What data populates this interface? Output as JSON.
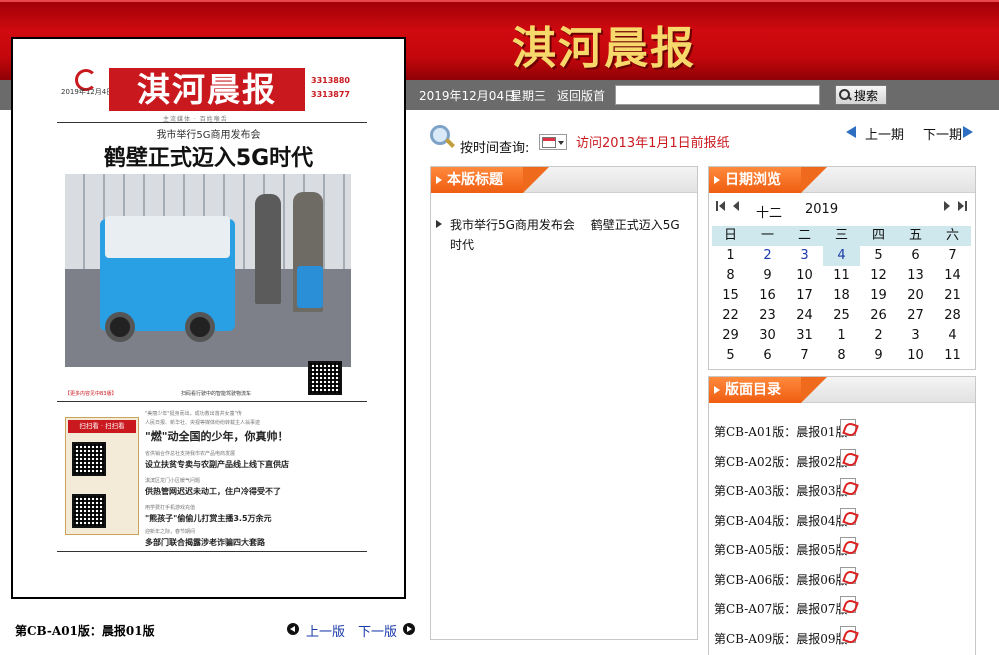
{
  "header": {
    "site_title": "淇河晨报",
    "date": "2019年12月04日",
    "weekday": "星期三",
    "home_link": "返回版首",
    "search_button": "搜索",
    "search_placeholder": ""
  },
  "newspaper": {
    "masthead": "淇河晨报",
    "issue_date": "2019年12月4日",
    "tel1": "3313880",
    "tel2": "3313877",
    "slogan": "主流媒体 · 百姓喉舌",
    "kicker": "我市举行5G商用发布会",
    "headline": "鹤壁正式迈入5G时代",
    "photo_note": "【更多内容见中B3版】",
    "qr_note": "扫码看行驶中的智能驾驶物流车",
    "box_tab": "扫扫看 · 扫扫看",
    "items": [
      {
        "kicker": "\"美丽少年\"挺身而出，成功救出落井女童\"传",
        "sub": "人民日报、新华社、央视等媒体纷纷转载主人翁事迹",
        "title": "\"燃\"动全国的少年，你真帅！",
        "ref": "详见03版"
      },
      {
        "kicker": "省供销合作总社支持我市农产品电商发展",
        "title": "设立扶贫专卖与农副产品线上线下直供店",
        "ref": "详见02版"
      },
      {
        "kicker": "淇滨区龙门小区暖气问题",
        "title": "供热管网迟迟未动工，住户冷得受不了",
        "ref": "详见07版"
      },
      {
        "kicker": "用学费打手机游戏充值",
        "title": "\"熊孩子\"偷偷儿打赏主播3.5万余元",
        "ref": "详见07版"
      },
      {
        "kicker": "迎新年之际，春节期间",
        "title": "多部门联合揭露涉老诈骗四大套路",
        "ref": "详见09版"
      }
    ]
  },
  "current_edition": "第CB-A01版：晨报01版",
  "pager": {
    "prev_edition": "上一版",
    "next_edition": "下一版"
  },
  "query": {
    "label": "按时间查询:",
    "archive_link": "访问2013年1月1日前报纸",
    "prev_period": "上一期",
    "next_period": "下一期"
  },
  "headline_panel": {
    "title": "本版标题",
    "items": [
      "我市举行5G商用发布会　 鹤壁正式迈入5G时代"
    ]
  },
  "calendar": {
    "title": "日期浏览",
    "month": "十二",
    "year": "2019",
    "weekdays": [
      "日",
      "一",
      "二",
      "三",
      "四",
      "五",
      "六"
    ],
    "weeks": [
      [
        "1",
        "2",
        "3",
        "4",
        "5",
        "6",
        "7"
      ],
      [
        "8",
        "9",
        "10",
        "11",
        "12",
        "13",
        "14"
      ],
      [
        "15",
        "16",
        "17",
        "18",
        "19",
        "20",
        "21"
      ],
      [
        "22",
        "23",
        "24",
        "25",
        "26",
        "27",
        "28"
      ],
      [
        "29",
        "30",
        "31",
        "1",
        "2",
        "3",
        "4"
      ],
      [
        "5",
        "6",
        "7",
        "8",
        "9",
        "10",
        "11"
      ]
    ],
    "linked_days": [
      "2",
      "3"
    ],
    "today": "4"
  },
  "pages_panel": {
    "title": "版面目录",
    "items": [
      "第CB-A01版：晨报01版",
      "第CB-A02版：晨报02版",
      "第CB-A03版：晨报03版",
      "第CB-A04版：晨报04版",
      "第CB-A05版：晨报05版",
      "第CB-A06版：晨报06版",
      "第CB-A07版：晨报07版",
      "第CB-A09版：晨报09版"
    ]
  },
  "colors": {
    "header_red": "#c3070c",
    "title_gold": "#f7d96b",
    "tab_orange": "#ef5d10",
    "link_blue": "#1a3aa8",
    "archive_red": "#c9191f",
    "calendar_cell": "#cfe8ee"
  }
}
